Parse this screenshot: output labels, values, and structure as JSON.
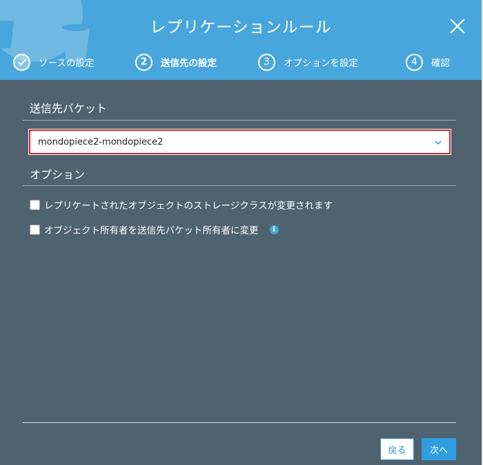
{
  "modal": {
    "title": "レプリケーションルール"
  },
  "steps": [
    {
      "number": "1",
      "label": "ソースの設定",
      "state": "done"
    },
    {
      "number": "2",
      "label": "送信先の設定",
      "state": "active"
    },
    {
      "number": "3",
      "label": "オプションを設定",
      "state": "pending"
    },
    {
      "number": "4",
      "label": "確認",
      "state": "pending"
    }
  ],
  "destination": {
    "heading": "送信先バケット",
    "selected_bucket": "mondopiece2-mondopiece2"
  },
  "options": {
    "heading": "オプション",
    "storage_class_label": "レプリケートされたオブジェクトのストレージクラスが変更されます",
    "owner_change_label": "オブジェクト所有者を送信先バケット所有者に変更"
  },
  "footer": {
    "back_label": "戻る",
    "next_label": "次へ"
  },
  "colors": {
    "header": "#47a6db",
    "body": "#4f6270",
    "highlight": "#d1242f",
    "primary": "#2f9ee0"
  },
  "icons": {
    "close": "close-icon",
    "step_done": "check-icon",
    "select": "chevron-down-icon",
    "info": "info-icon"
  }
}
